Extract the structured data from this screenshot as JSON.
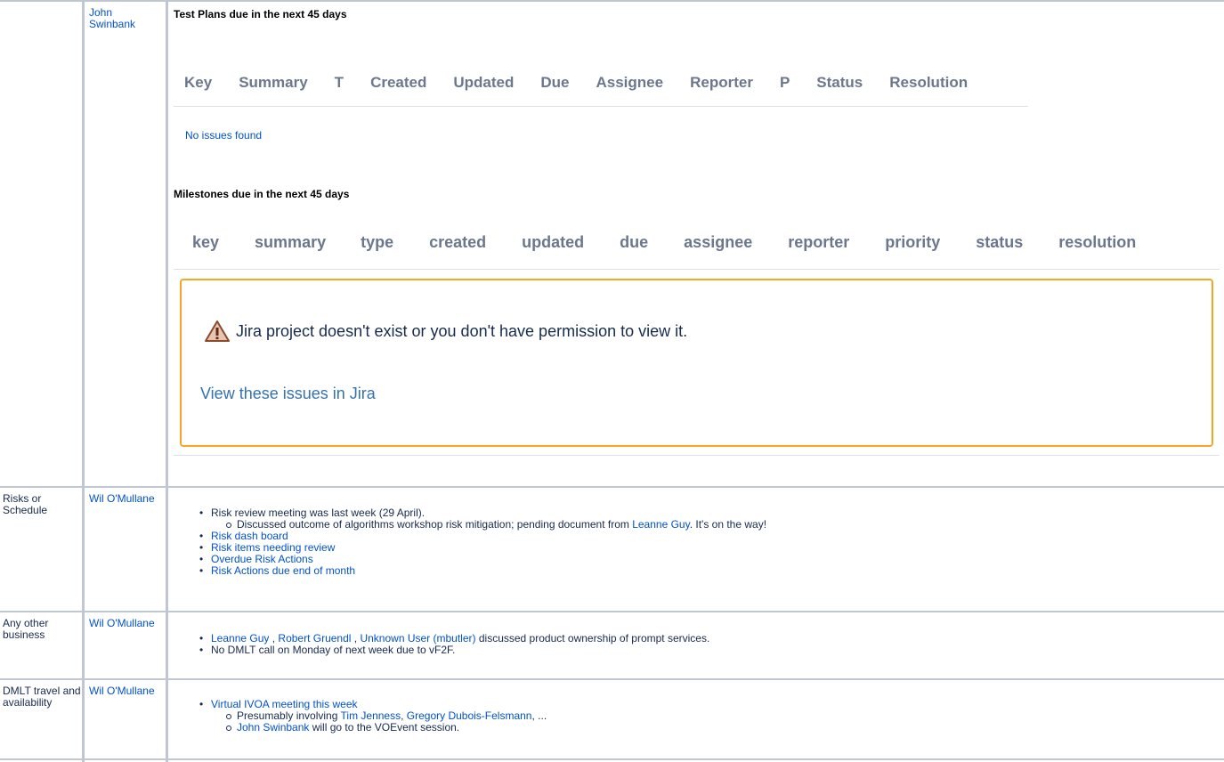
{
  "row_project": {
    "owner": "John Swinbank",
    "test_plans_title": "Test Plans due in the next 45 days",
    "test_plans_headers": [
      "Key",
      "Summary",
      "T",
      "Created",
      "Updated",
      "Due",
      "Assignee",
      "Reporter",
      "P",
      "Status",
      "Resolution"
    ],
    "test_plans_empty": "No issues found",
    "milestones_title": "Milestones due in the next 45 days",
    "milestones_headers": [
      "key",
      "summary",
      "type",
      "created",
      "updated",
      "due",
      "assignee",
      "reporter",
      "priority",
      "status",
      "resolution"
    ],
    "warning_message": "Jira project doesn't exist or you don't have permission to view it.",
    "warning_link": "View these issues in Jira",
    "warning_icon": "warning-triangle-icon",
    "warning_color": "#f5a623"
  },
  "row_risks": {
    "topic": "Risks or Schedule",
    "owner": "Wil O'Mullane",
    "item1": "Risk review meeting was last week (29 April).",
    "item1_sub_pre": "Discussed outcome of algorithms workshop risk mitigation; pending document from ",
    "item1_sub_link": "Leanne Guy",
    "item1_sub_post": ". It's on the way!",
    "links": [
      "Risk dash board",
      "Risk items needing review",
      "Overdue Risk Actions",
      "Risk Actions due end of month"
    ]
  },
  "row_aob": {
    "topic": "Any other business",
    "owner": "Wil O'Mullane",
    "people": [
      "Leanne Guy",
      "Robert Gruendl",
      "Unknown User (mbutler)"
    ],
    "sep1": " , ",
    "sep2": " , ",
    "item1_post": " discussed product ownership of prompt services.",
    "item2": "No DMLT call on Monday of next week due to vF2F."
  },
  "row_travel": {
    "topic": "DMLT travel and availability",
    "owner": "Wil O'Mullane",
    "item1": "Virtual IVOA meeting this week",
    "sub1_pre": "Presumably involving ",
    "sub1_people": [
      "Tim Jenness",
      "Gregory Dubois-Felsmann"
    ],
    "sub1_sep": ", ",
    "sub1_post": ", ...",
    "sub2_link": "John Swinbank",
    "sub2_post": " will go to the VOEvent session."
  }
}
